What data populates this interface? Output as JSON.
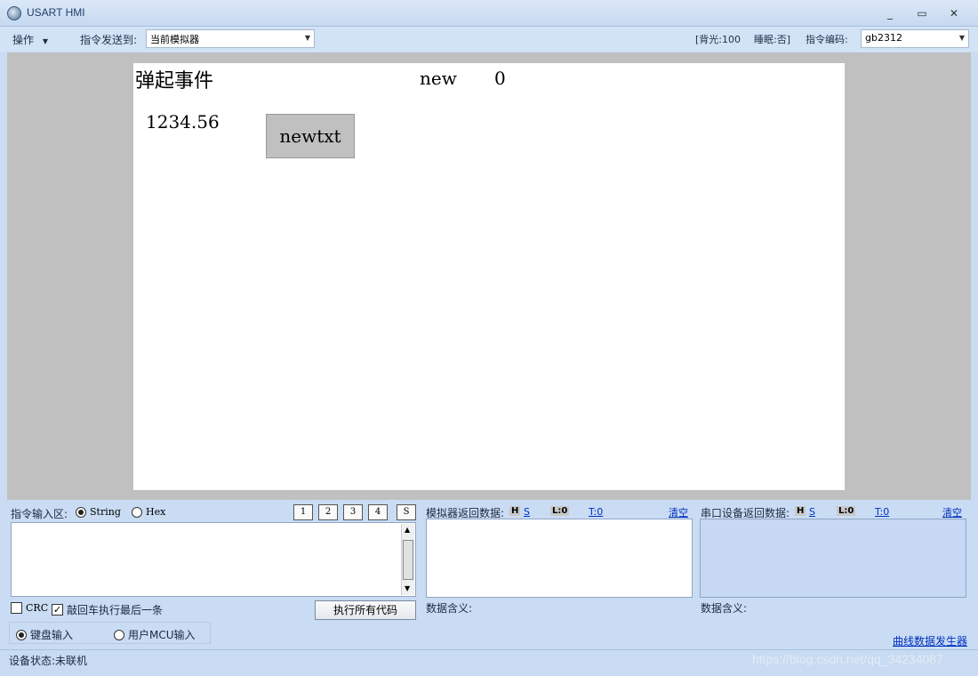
{
  "window": {
    "title": "USART HMI",
    "controls": [
      "_",
      "▭",
      "✕"
    ]
  },
  "toolbar": {
    "menu_label": "操作",
    "send_to_label": "指令发送到:",
    "send_to_value": "当前模拟器",
    "backlight": "[背光:100",
    "sleep": "睡眠:否]",
    "encoding_label": "指令编码:",
    "encoding_value": "gb2312"
  },
  "simulator": {
    "popup_event_text": "弹起事件",
    "new_text": "new",
    "zero_text": "0",
    "number_text": "1234.56",
    "button_text": "newtxt"
  },
  "input_panel": {
    "label": "指令输入区:",
    "string_label": "String",
    "hex_label": "Hex",
    "string_selected": true,
    "page_buttons": [
      "1",
      "2",
      "3",
      "4",
      "S"
    ],
    "crc_label": "CRC",
    "crc_checked": false,
    "enter_label": "敲回车执行最后一条",
    "enter_checked": true,
    "execute_all_label": "执行所有代码",
    "keyboard_input_label": "键盘输入",
    "mcu_input_label": "用户MCU输入",
    "keyboard_selected": true
  },
  "sim_return": {
    "label": "模拟器返回数据:",
    "h": "H",
    "s": "S",
    "l": "L:0",
    "t": "T:0",
    "clear": "清空",
    "meaning_label": "数据含义:"
  },
  "serial_return": {
    "label": "串口设备返回数据:",
    "h": "H",
    "s": "S",
    "l": "L:0",
    "t": "T:0",
    "clear": "清空",
    "meaning_label": "数据含义:"
  },
  "curve_generator_link": "曲线数据发生器",
  "status": {
    "device_status": "设备状态:未联机",
    "watermark": "https://blog.csdn.net/qq_34234087"
  }
}
